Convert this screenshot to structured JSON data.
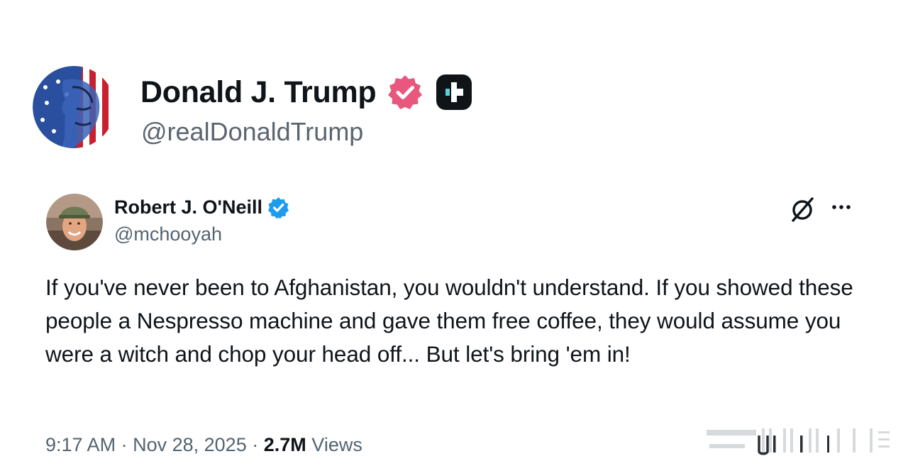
{
  "top_post": {
    "display_name": "Donald J. Trump",
    "handle": "@realDonaldTrump",
    "avatar_icon": "flag-portrait-avatar",
    "verified_icon": "verified-badge-icon",
    "verified_color": "#e8577d",
    "plus_icon": "truth-plus-icon"
  },
  "quoted_tweet": {
    "display_name": "Robert J. O'Neill",
    "handle": "@mchooyah",
    "verified_color": "#1d9bf0",
    "text": "If you've never been to Afghanistan, you wouldn't understand. If you showed these people a Nespresso machine and gave them free coffee, they would assume you were a witch and chop your head off... But let's bring 'em in!",
    "time": "9:17 AM",
    "separator": "·",
    "date": "Nov 28, 2025",
    "views_count": "2.7M",
    "views_label": "Views",
    "grok_icon": "grok-icon",
    "more_icon": "more-options-icon"
  }
}
